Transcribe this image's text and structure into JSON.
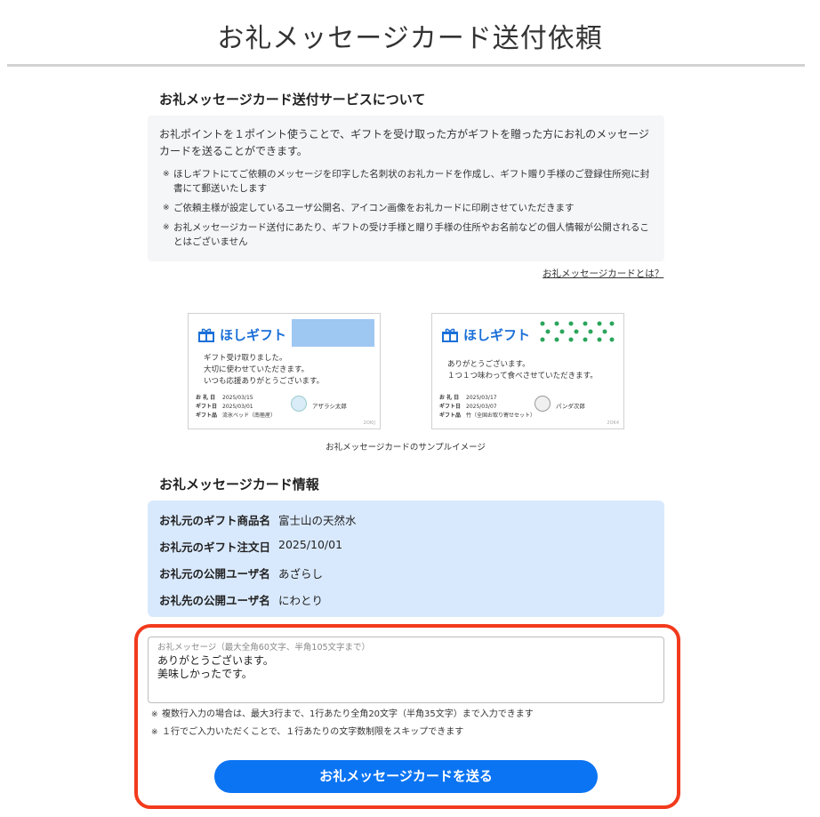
{
  "page": {
    "title": "お礼メッセージカード送付依頼"
  },
  "about": {
    "heading": "お礼メッセージカード送付サービスについて",
    "lead": "お礼ポイントを１ポイント使うことで、ギフトを受け取った方がギフトを贈った方にお礼のメッセージカードを送ることができます。",
    "note_mark": "※",
    "notes": [
      "ほしギフトにてご依頼のメッセージを印字した名刺状のお礼カードを作成し、ギフト贈り手様のご登録住所宛に封書にて郵送いたします",
      "ご依頼主様が設定しているユーザ公開名、アイコン画像をお礼カードに印刷させていただきます",
      "お礼メッセージカード送付にあたり、ギフトの受け手様と贈り手様の住所やお名前などの個人情報が公開されることはございません"
    ],
    "link_label": "お礼メッセージカードとは？"
  },
  "samples": {
    "brand": "ほしギフト",
    "caption": "お礼メッセージカードのサンプルイメージ",
    "cards": [
      {
        "message": "ギフト受け取りました。\n大切に使わせていただきます。\nいつも応援ありがとうございます。",
        "meta": [
          {
            "k": "お 礼 日",
            "v": "2025/03/15"
          },
          {
            "k": "ギフト日",
            "v": "2025/03/01"
          },
          {
            "k": "ギフト品",
            "v": "流氷ベッド（南極産）"
          }
        ],
        "sender": "アザラシ太郎",
        "serial": "2OKIJ"
      },
      {
        "message": "ありがとうございます。\n１つ１つ味わって食べさせていただきます。",
        "meta": [
          {
            "k": "お 礼 日",
            "v": "2025/03/17"
          },
          {
            "k": "ギフト日",
            "v": "2025/03/07"
          },
          {
            "k": "ギフト品",
            "v": "竹（全国お取り寄せセット）"
          }
        ],
        "sender": "パンダ次郎",
        "serial": "2OK4"
      }
    ]
  },
  "info": {
    "heading": "お礼メッセージカード情報",
    "rows": [
      {
        "label": "お礼元のギフト商品名",
        "value": "富士山の天然水"
      },
      {
        "label": "お礼元のギフト注文日",
        "value": "2025/10/01"
      },
      {
        "label": "お礼元の公開ユーザ名",
        "value": "あざらし"
      },
      {
        "label": "お礼先の公開ユーザ名",
        "value": "にわとり"
      }
    ]
  },
  "message_input": {
    "placeholder": "お礼メッセージ（最大全角60文字、半角105文字まで）",
    "value": "ありがとうございます。\n美味しかったです。",
    "notes": [
      "複数行入力の場合は、最大3行まで、1行あたり全角20文字（半角35文字）まで入力できます",
      "１行でご入力いただくことで、１行あたりの文字数制限をスキップできます"
    ]
  },
  "submit": {
    "label": "お礼メッセージカードを送る"
  },
  "colors": {
    "accent": "#0b74f3",
    "highlight": "#f23a1d",
    "info_bg": "#d9e9fd",
    "brand": "#1a6fd8"
  }
}
